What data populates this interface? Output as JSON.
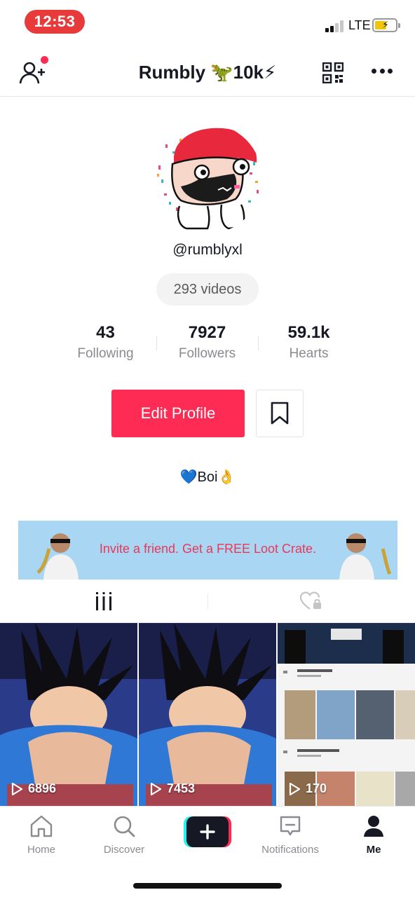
{
  "status_bar": {
    "time": "12:53",
    "network": "LTE"
  },
  "header": {
    "title": "Rumbly 🦖10k⚡",
    "icons": [
      "add-user-icon",
      "qr-code-icon",
      "more-options-icon"
    ]
  },
  "profile": {
    "username": "@rumblyxl",
    "videos_count_label": "293 videos",
    "bio": "💙Boi👌"
  },
  "stats": [
    {
      "value": "43",
      "label": "Following"
    },
    {
      "value": "7927",
      "label": "Followers"
    },
    {
      "value": "59.1k",
      "label": "Hearts"
    }
  ],
  "actions": {
    "edit_profile_label": "Edit Profile"
  },
  "banner": {
    "text": "Invite a friend. Get a FREE Loot Crate."
  },
  "videos": [
    {
      "views": "6896"
    },
    {
      "views": "7453"
    },
    {
      "views": "170"
    }
  ],
  "bottom_nav": [
    {
      "label": "Home",
      "icon": "home-icon"
    },
    {
      "label": "Discover",
      "icon": "search-icon"
    },
    {
      "label": "",
      "icon": "plus-icon"
    },
    {
      "label": "Notifications",
      "icon": "inbox-icon"
    },
    {
      "label": "Me",
      "icon": "profile-icon",
      "active": true
    }
  ],
  "colors": {
    "accent": "#fe2c55",
    "time_pill": "#e8393b",
    "banner_bg": "#a9d6f2"
  }
}
